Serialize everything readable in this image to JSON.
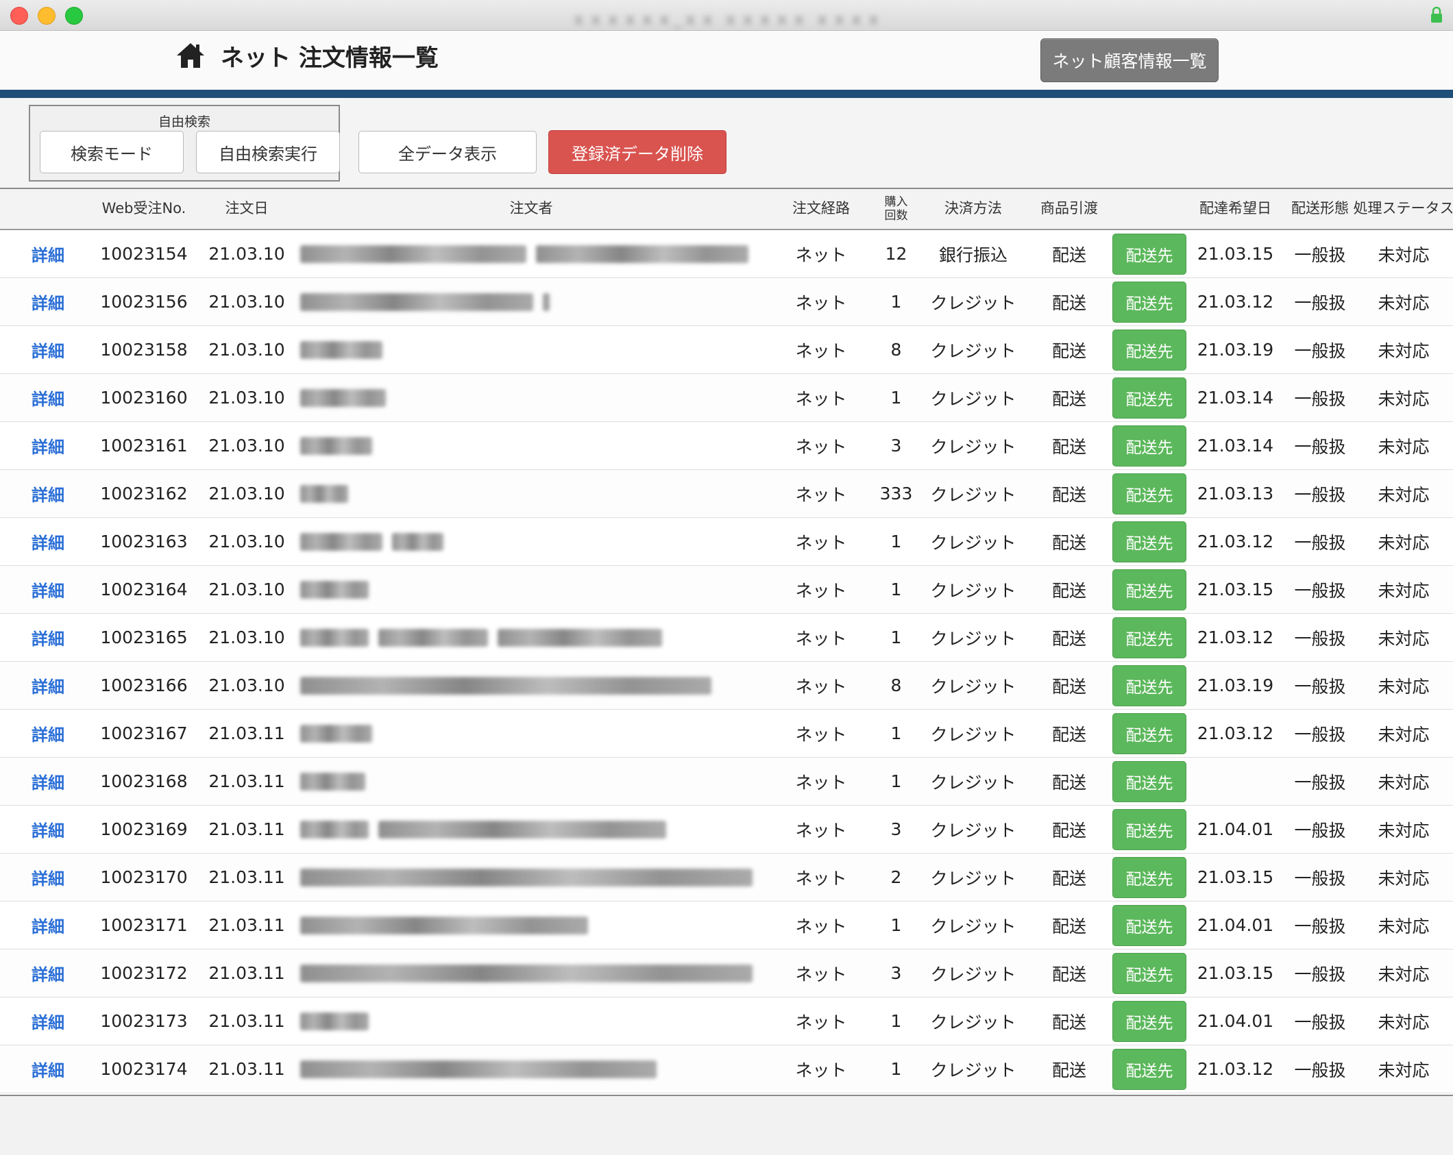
{
  "window": {
    "title": "ｘｘｘｘｘｘ_ｘｘ ｘｘｘｘｘ ｘｘｘｘ"
  },
  "header": {
    "title": "ネット 注文情報一覧",
    "customer_button": "ネット顧客情報一覧"
  },
  "toolbar": {
    "free_search_label": "自由検索",
    "search_mode": "検索モード",
    "free_search_exec": "自由検索実行",
    "show_all": "全データ表示",
    "delete_registered": "登録済データ削除"
  },
  "table": {
    "headers": {
      "web_no": "Web受注No.",
      "order_date": "注文日",
      "orderer": "注文者",
      "route": "注文経路",
      "purchase_count": "購入\n回数",
      "payment": "決済方法",
      "delivery": "商品引渡",
      "desired_date": "配達希望日",
      "ship_type": "配送形態",
      "status": "処理ステータス"
    },
    "rows": [
      {
        "detail": "詳細",
        "no": "10023154",
        "date": "21.03.10",
        "route": "ネット",
        "count": "12",
        "payment": "銀行振込",
        "delivery": "配送",
        "ship": "配送先",
        "desired": "21.03.15",
        "type": "一般扱",
        "status": "未対応"
      },
      {
        "detail": "詳細",
        "no": "10023156",
        "date": "21.03.10",
        "route": "ネット",
        "count": "1",
        "payment": "クレジット",
        "delivery": "配送",
        "ship": "配送先",
        "desired": "21.03.12",
        "type": "一般扱",
        "status": "未対応"
      },
      {
        "detail": "詳細",
        "no": "10023158",
        "date": "21.03.10",
        "route": "ネット",
        "count": "8",
        "payment": "クレジット",
        "delivery": "配送",
        "ship": "配送先",
        "desired": "21.03.19",
        "type": "一般扱",
        "status": "未対応"
      },
      {
        "detail": "詳細",
        "no": "10023160",
        "date": "21.03.10",
        "route": "ネット",
        "count": "1",
        "payment": "クレジット",
        "delivery": "配送",
        "ship": "配送先",
        "desired": "21.03.14",
        "type": "一般扱",
        "status": "未対応"
      },
      {
        "detail": "詳細",
        "no": "10023161",
        "date": "21.03.10",
        "route": "ネット",
        "count": "3",
        "payment": "クレジット",
        "delivery": "配送",
        "ship": "配送先",
        "desired": "21.03.14",
        "type": "一般扱",
        "status": "未対応"
      },
      {
        "detail": "詳細",
        "no": "10023162",
        "date": "21.03.10",
        "route": "ネット",
        "count": "333",
        "payment": "クレジット",
        "delivery": "配送",
        "ship": "配送先",
        "desired": "21.03.13",
        "type": "一般扱",
        "status": "未対応"
      },
      {
        "detail": "詳細",
        "no": "10023163",
        "date": "21.03.10",
        "route": "ネット",
        "count": "1",
        "payment": "クレジット",
        "delivery": "配送",
        "ship": "配送先",
        "desired": "21.03.12",
        "type": "一般扱",
        "status": "未対応"
      },
      {
        "detail": "詳細",
        "no": "10023164",
        "date": "21.03.10",
        "route": "ネット",
        "count": "1",
        "payment": "クレジット",
        "delivery": "配送",
        "ship": "配送先",
        "desired": "21.03.15",
        "type": "一般扱",
        "status": "未対応"
      },
      {
        "detail": "詳細",
        "no": "10023165",
        "date": "21.03.10",
        "route": "ネット",
        "count": "1",
        "payment": "クレジット",
        "delivery": "配送",
        "ship": "配送先",
        "desired": "21.03.12",
        "type": "一般扱",
        "status": "未対応"
      },
      {
        "detail": "詳細",
        "no": "10023166",
        "date": "21.03.10",
        "route": "ネット",
        "count": "8",
        "payment": "クレジット",
        "delivery": "配送",
        "ship": "配送先",
        "desired": "21.03.19",
        "type": "一般扱",
        "status": "未対応"
      },
      {
        "detail": "詳細",
        "no": "10023167",
        "date": "21.03.11",
        "route": "ネット",
        "count": "1",
        "payment": "クレジット",
        "delivery": "配送",
        "ship": "配送先",
        "desired": "21.03.12",
        "type": "一般扱",
        "status": "未対応"
      },
      {
        "detail": "詳細",
        "no": "10023168",
        "date": "21.03.11",
        "route": "ネット",
        "count": "1",
        "payment": "クレジット",
        "delivery": "配送",
        "ship": "配送先",
        "desired": "",
        "type": "一般扱",
        "status": "未対応"
      },
      {
        "detail": "詳細",
        "no": "10023169",
        "date": "21.03.11",
        "route": "ネット",
        "count": "3",
        "payment": "クレジット",
        "delivery": "配送",
        "ship": "配送先",
        "desired": "21.04.01",
        "type": "一般扱",
        "status": "未対応"
      },
      {
        "detail": "詳細",
        "no": "10023170",
        "date": "21.03.11",
        "route": "ネット",
        "count": "2",
        "payment": "クレジット",
        "delivery": "配送",
        "ship": "配送先",
        "desired": "21.03.15",
        "type": "一般扱",
        "status": "未対応"
      },
      {
        "detail": "詳細",
        "no": "10023171",
        "date": "21.03.11",
        "route": "ネット",
        "count": "1",
        "payment": "クレジット",
        "delivery": "配送",
        "ship": "配送先",
        "desired": "21.04.01",
        "type": "一般扱",
        "status": "未対応"
      },
      {
        "detail": "詳細",
        "no": "10023172",
        "date": "21.03.11",
        "route": "ネット",
        "count": "3",
        "payment": "クレジット",
        "delivery": "配送",
        "ship": "配送先",
        "desired": "21.03.15",
        "type": "一般扱",
        "status": "未対応"
      },
      {
        "detail": "詳細",
        "no": "10023173",
        "date": "21.03.11",
        "route": "ネット",
        "count": "1",
        "payment": "クレジット",
        "delivery": "配送",
        "ship": "配送先",
        "desired": "21.04.01",
        "type": "一般扱",
        "status": "未対応"
      },
      {
        "detail": "詳細",
        "no": "10023174",
        "date": "21.03.11",
        "route": "ネット",
        "count": "1",
        "payment": "クレジット",
        "delivery": "配送",
        "ship": "配送先",
        "desired": "21.03.12",
        "type": "一般扱",
        "status": "未対応"
      }
    ]
  },
  "colors": {
    "header_divider": "#1f4e79",
    "delete_button": "#d9534f",
    "ship_button": "#5cb85c",
    "detail_link": "#2b6fd6",
    "customer_button": "#7b7b7b"
  },
  "icons": {
    "home": "home-icon",
    "lock": "lock-icon"
  }
}
